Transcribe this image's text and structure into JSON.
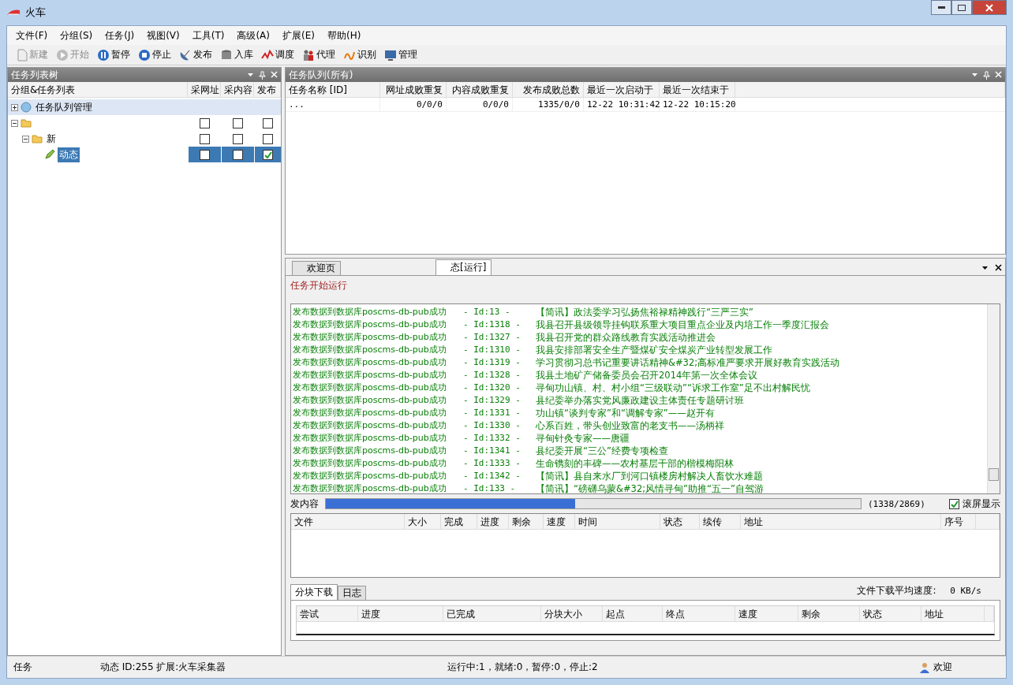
{
  "window": {
    "title": "火车"
  },
  "menu": [
    "文件(F)",
    "分组(S)",
    "任务(J)",
    "视图(V)",
    "工具(T)",
    "高级(A)",
    "扩展(E)",
    "帮助(H)"
  ],
  "toolbar": [
    {
      "label": "新建",
      "kind": "new",
      "disabled": true
    },
    {
      "label": "开始",
      "kind": "start",
      "disabled": true
    },
    {
      "label": "暂停",
      "kind": "pause",
      "disabled": false
    },
    {
      "label": "停止",
      "kind": "stop",
      "disabled": false
    },
    {
      "label": "发布",
      "kind": "publish",
      "disabled": false
    },
    {
      "label": "入库",
      "kind": "sql",
      "disabled": false
    },
    {
      "label": "调度",
      "kind": "schedule",
      "disabled": false
    },
    {
      "label": "代理",
      "kind": "proxy",
      "disabled": false
    },
    {
      "label": "识别",
      "kind": "ocr",
      "disabled": false
    },
    {
      "label": "管理",
      "kind": "manage",
      "disabled": false
    }
  ],
  "tree_panel": {
    "title": "任务列表树",
    "columns": [
      "分组&任务列表",
      "采网址",
      "采内容",
      "发布"
    ],
    "items": [
      {
        "kind": "queue",
        "label": "任务队列管理",
        "selected": false,
        "expanded": false
      },
      {
        "kind": "folder",
        "expanded": true,
        "checks": [
          false,
          false,
          false
        ],
        "children": [
          {
            "kind": "folder",
            "label": "新",
            "selected": false,
            "expanded": true,
            "checks": [
              false,
              false,
              false
            ],
            "children": [
              {
                "kind": "task",
                "label": "动态",
                "selected": true,
                "checks": [
                  false,
                  false,
                  true
                ]
              }
            ]
          }
        ]
      }
    ]
  },
  "queue_panel": {
    "title": "任务队列(所有)",
    "columns": [
      "任务名称 [ID]",
      "网址成败重复",
      "内容成败重复",
      "发布成败总数",
      "最近一次启动于",
      "最近一次结束于"
    ],
    "rows": [
      [
        "...",
        "0/0/0",
        "0/0/0",
        "1335/0/0",
        "12-22 10:31:42",
        "12-22 10:15:20"
      ]
    ]
  },
  "run_panel": {
    "tabs": [
      {
        "label": "欢迎页",
        "selected": false
      },
      {
        "label": "态[运行]",
        "selected": true
      }
    ],
    "status": "任务开始运行",
    "log": [
      {
        "source": "发布数据到数据库poscms-db-pub成功",
        "id": "- Id:13 -",
        "title": "【简讯】政法委学习弘扬焦裕禄精神践行“三严三实”"
      },
      {
        "source": "发布数据到数据库poscms-db-pub成功",
        "id": "- Id:1318 -",
        "title": "我县召开县级领导挂钩联系重大项目重点企业及内培工作一季度汇报会"
      },
      {
        "source": "发布数据到数据库poscms-db-pub成功",
        "id": "- Id:1327 -",
        "title": "我县召开党的群众路线教育实践活动推进会"
      },
      {
        "source": "发布数据到数据库poscms-db-pub成功",
        "id": "- Id:1310 -",
        "title": "我县安排部署安全生产暨煤矿安全煤炭产业转型发展工作"
      },
      {
        "source": "发布数据到数据库poscms-db-pub成功",
        "id": "- Id:1319 -",
        "title": "学习贯彻习总书记重要讲话精神&#32;高标准严要求开展好教育实践活动"
      },
      {
        "source": "发布数据到数据库poscms-db-pub成功",
        "id": "- Id:1328 -",
        "title": "我县土地矿产储备委员会召开2014年第一次全体会议"
      },
      {
        "source": "发布数据到数据库poscms-db-pub成功",
        "id": "- Id:1320 -",
        "title": "寻甸功山镇、村、村小组“三级联动”“诉求工作室”足不出村解民忧"
      },
      {
        "source": "发布数据到数据库poscms-db-pub成功",
        "id": "- Id:1329 -",
        "title": "县纪委举办落实党风廉政建设主体责任专题研讨班"
      },
      {
        "source": "发布数据到数据库poscms-db-pub成功",
        "id": "- Id:1331 -",
        "title": "功山镇“谈判专家”和“调解专家”——赵开有"
      },
      {
        "source": "发布数据到数据库poscms-db-pub成功",
        "id": "- Id:1330 -",
        "title": "心系百姓，带头创业致富的老支书——汤柄祥"
      },
      {
        "source": "发布数据到数据库poscms-db-pub成功",
        "id": "- Id:1332 -",
        "title": "寻甸针灸专家——唐疆"
      },
      {
        "source": "发布数据到数据库poscms-db-pub成功",
        "id": "- Id:1341 -",
        "title": "县纪委开展“三公”经费专项检查"
      },
      {
        "source": "发布数据到数据库poscms-db-pub成功",
        "id": "- Id:1333 -",
        "title": "生命镌刻的丰碑——农村基层干部的楷模梅阳林"
      },
      {
        "source": "发布数据到数据库poscms-db-pub成功",
        "id": "- Id:1342 -",
        "title": "【简讯】县自来水厂到河口镇楼房村解决人畜饮水难题"
      },
      {
        "source": "发布数据到数据库poscms-db-pub成功",
        "id": "- Id:133 -",
        "title": "【简讯】“磅礴乌蒙&#32;风情寻甸”助推“五一”自驾游"
      }
    ],
    "progress": {
      "label": "发内容",
      "level": 0.4664,
      "reading": "(1338/2869)"
    },
    "scroll_display": {
      "label": "滚屏显示",
      "checked": true
    },
    "files_columns": [
      "文件",
      "大小",
      "完成",
      "进度",
      "剩余",
      "速度",
      "时间",
      "状态",
      "续传",
      "地址",
      "序号"
    ],
    "bottom_tabs": [
      {
        "label": "分块下载",
        "selected": true
      },
      {
        "label": "日志",
        "selected": false
      }
    ],
    "avg_speed": {
      "label": "文件下载平均速度:",
      "value": "0 KB/s"
    },
    "chunk_columns": [
      "尝试",
      "进度",
      "已完成",
      "分块大小",
      "起点",
      "终点",
      "速度",
      "剩余",
      "状态",
      "地址"
    ]
  },
  "status_bar": {
    "left": [
      "任务",
      "动态 ID:255 扩展:火车采集器"
    ],
    "center": "运行中:1，就绪:0，暂停:0，停止:2",
    "right": "欢迎"
  }
}
